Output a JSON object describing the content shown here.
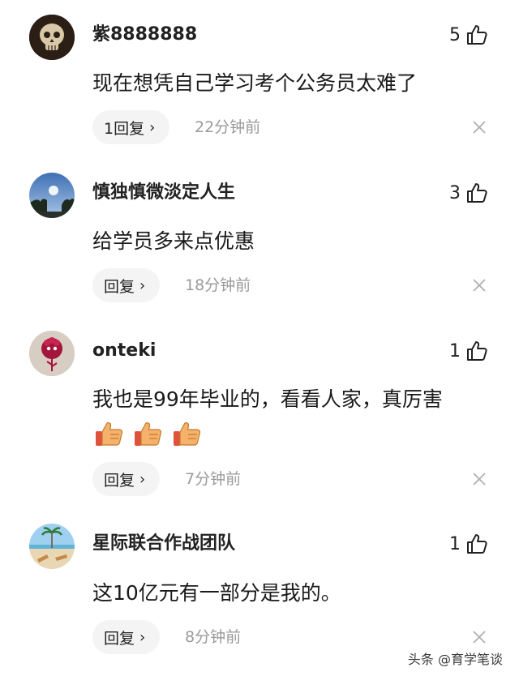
{
  "comments": [
    {
      "username": "紫8888888",
      "likes": "5",
      "text": "现在想凭自己学习考个公务员太难了",
      "reply_label": "1回复",
      "time": "22分钟前",
      "avatar": "skull-avatar"
    },
    {
      "username": "慎独慎微淡定人生",
      "likes": "3",
      "text": "给学员多来点优惠",
      "reply_label": "回复",
      "time": "18分钟前",
      "avatar": "sky-tree-avatar"
    },
    {
      "username": "onteki",
      "likes": "1",
      "text": "我也是99年毕业的，看看人家，真厉害",
      "emojis": [
        "thumbs-up-emoji",
        "thumbs-up-emoji",
        "thumbs-up-emoji"
      ],
      "reply_label": "回复",
      "time": "7分钟前",
      "avatar": "red-flower-avatar"
    },
    {
      "username": "星际联合作战团队",
      "likes": "1",
      "text": "这10亿元有一部分是我的。",
      "reply_label": "回复",
      "time": "8分钟前",
      "avatar": "beach-avatar"
    }
  ],
  "chevron": "›",
  "watermark": "头条 @育学笔谈",
  "colors": {
    "reply_bg": "#f4f4f4",
    "time": "#9a9a9a",
    "text": "#1a1a1a"
  }
}
